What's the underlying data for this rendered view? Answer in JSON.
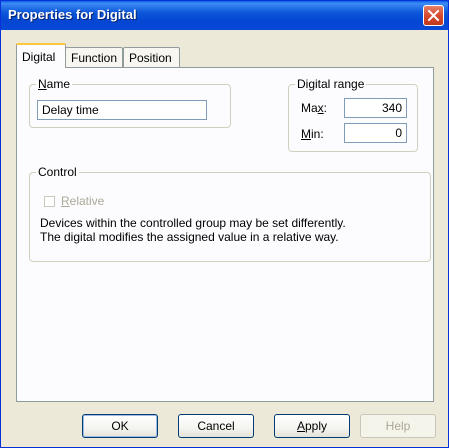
{
  "window": {
    "title": "Properties for Digital"
  },
  "tabs": [
    {
      "label": "Digital",
      "active": true
    },
    {
      "label": "Function",
      "active": false
    },
    {
      "label": "Position",
      "active": false
    }
  ],
  "name_group": {
    "label_prefix": "",
    "label_accel": "N",
    "label_rest": "ame",
    "value": "Delay time"
  },
  "range_group": {
    "label": "Digital range",
    "max_label_prefix": "Ma",
    "max_label_accel": "x",
    "max_label_rest": ":",
    "max_value": "340",
    "min_label_prefix": "",
    "min_label_accel": "M",
    "min_label_rest": "in:",
    "min_value": "0"
  },
  "control_group": {
    "label": "Control",
    "relative_accel": "R",
    "relative_rest": "elative",
    "relative_checked": false,
    "relative_enabled": false,
    "description_line1": "Devices within the controlled group may be set differently.",
    "description_line2": "The digital modifies the assigned value in a relative way."
  },
  "buttons": {
    "ok": "OK",
    "cancel": "Cancel",
    "apply_accel": "A",
    "apply_rest": "pply",
    "help": "Help"
  },
  "colors": {
    "titlebar": "#0a5fe6",
    "close_button": "#d6492f",
    "active_tab_highlight": "#ffc73c",
    "disabled_text": "#aca899"
  }
}
